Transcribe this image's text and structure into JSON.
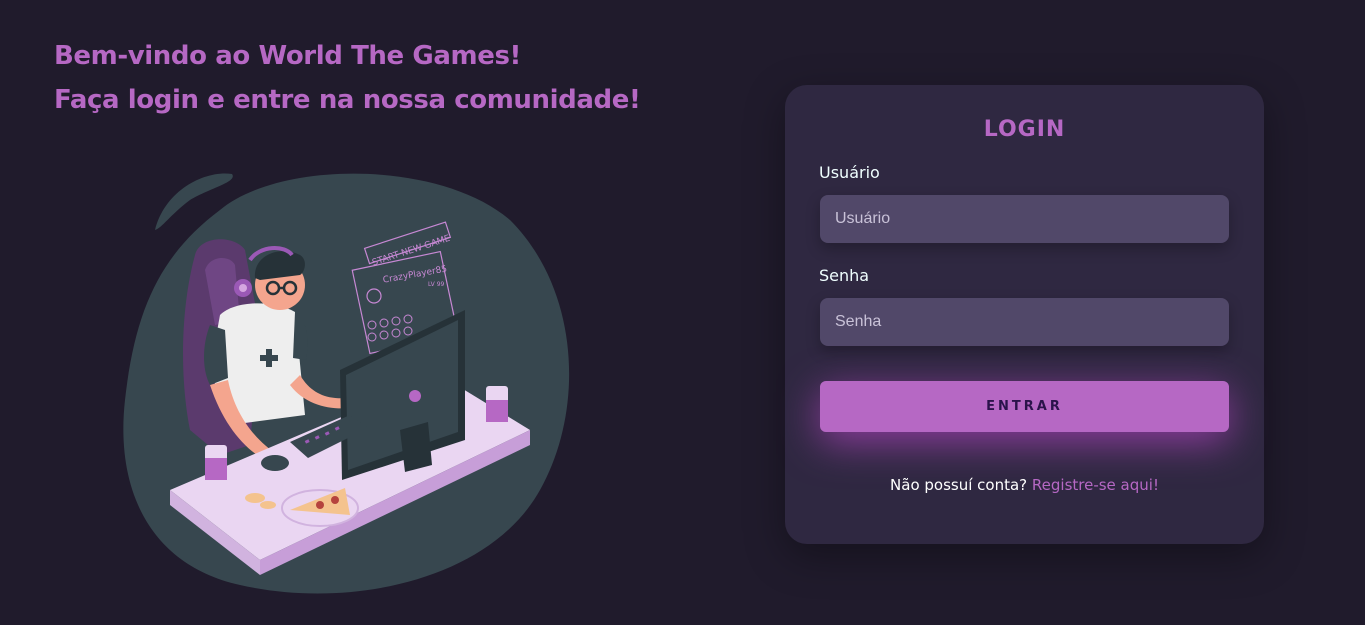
{
  "welcome": {
    "line1": "Bem-vindo ao World The Games!",
    "line2": "Faça login e entre na nossa comunidade!"
  },
  "illustration": {
    "screen_title": "START NEW GAME",
    "player_name": "CrazyPlayer85",
    "level": "LV 99"
  },
  "login": {
    "title": "LOGIN",
    "username_label": "Usuário",
    "username_placeholder": "Usuário",
    "password_label": "Senha",
    "password_placeholder": "Senha",
    "submit_label": "ENTRAR",
    "signup_prompt": "Não possuí conta?",
    "signup_link": "Registre-se aqui!"
  },
  "colors": {
    "background": "#201b2c",
    "card": "#2f2841",
    "accent": "#b668c4",
    "input": "#514869"
  }
}
